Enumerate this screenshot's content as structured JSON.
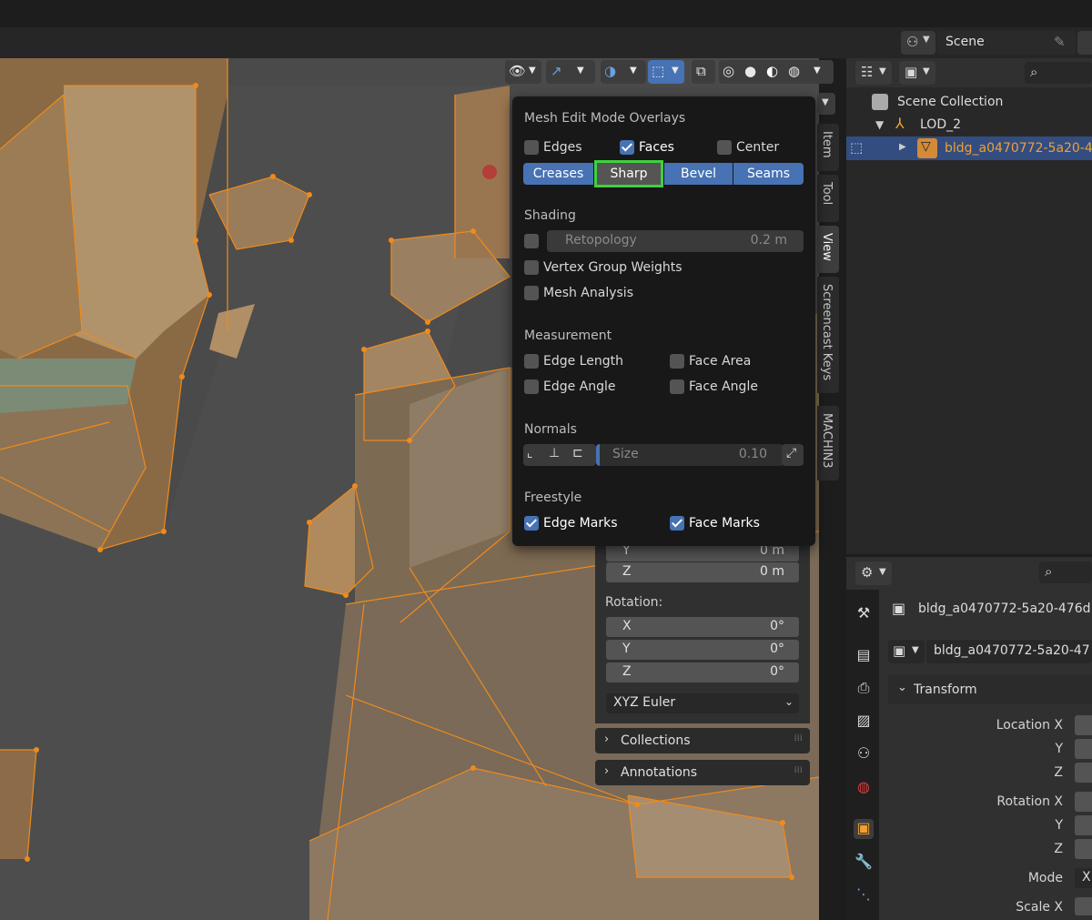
{
  "header": {
    "scene_label": "Scene"
  },
  "overlay_popup": {
    "title": "Mesh Edit Mode Overlays",
    "edges_label": "Edges",
    "faces_label": "Faces",
    "center_label": "Center",
    "segments": [
      "Creases",
      "Sharp",
      "Bevel",
      "Seams"
    ],
    "shading_title": "Shading",
    "retopology_label": "Retopology",
    "retopology_value": "0.2 m",
    "vertex_group_weights_label": "Vertex Group Weights",
    "mesh_analysis_label": "Mesh Analysis",
    "measurement_title": "Measurement",
    "edge_length_label": "Edge Length",
    "face_area_label": "Face Area",
    "edge_angle_label": "Edge Angle",
    "face_angle_label": "Face Angle",
    "normals_title": "Normals",
    "size_label": "Size",
    "size_value": "0.10",
    "freestyle_title": "Freestyle",
    "edge_marks_label": "Edge Marks",
    "face_marks_label": "Face Marks",
    "highlight_color": "#3fd13f"
  },
  "npanel": {
    "location_y_label": "Y",
    "location_y_value": "0 m",
    "location_z_label": "Z",
    "location_z_value": "0 m",
    "rotation_title": "Rotation:",
    "rot_x_label": "X",
    "rot_x_value": "0°",
    "rot_y_label": "Y",
    "rot_y_value": "0°",
    "rot_z_label": "Z",
    "rot_z_value": "0°",
    "rotation_mode": "XYZ Euler",
    "collections_label": "Collections",
    "annotations_label": "Annotations"
  },
  "side_tabs": [
    "Item",
    "Tool",
    "View",
    "Screencast Keys",
    "MACHIN3"
  ],
  "outliner": {
    "scene_collection": "Scene Collection",
    "lod_label": "LOD_2",
    "object_label": "bldg_a0470772-5a20-4"
  },
  "properties": {
    "object_name": "bldg_a0470772-5a20-476d",
    "data_name": "bldg_a0470772-5a20-47",
    "transform_title": "Transform",
    "location_x_label": "Location X",
    "y_label": "Y",
    "z_label": "Z",
    "rotation_x_label": "Rotation X",
    "ry_label": "Y",
    "rz_label": "Z",
    "mode_label": "Mode",
    "mode_value": "X",
    "scale_x_label": "Scale X"
  }
}
